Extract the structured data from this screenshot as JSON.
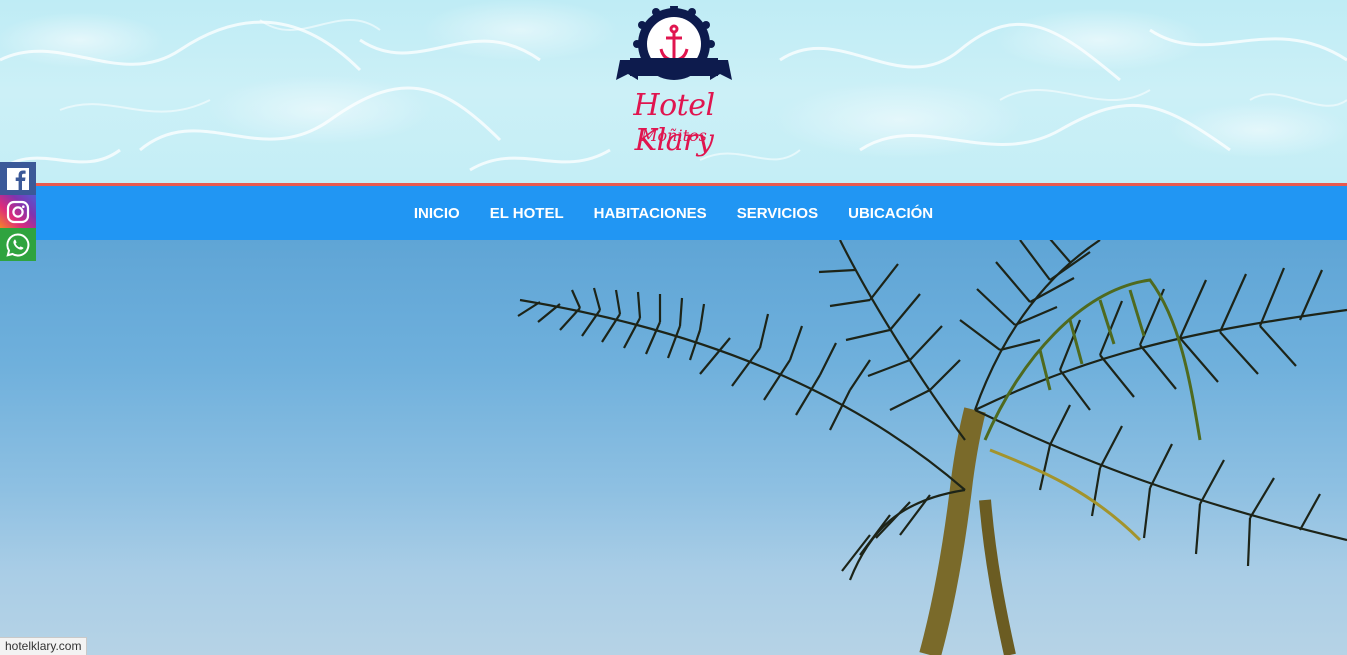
{
  "logo": {
    "title": "Hotel Klary",
    "subtitle": "Moñitos",
    "icon": "anchor-icon",
    "brand_color": "#e0154f",
    "badge_color": "#0d1b4d"
  },
  "nav": {
    "background": "#2196f3",
    "border_color": "#e95a4f",
    "items": [
      {
        "label": "INICIO"
      },
      {
        "label": "EL HOTEL"
      },
      {
        "label": "HABITACIONES"
      },
      {
        "label": "SERVICIOS"
      },
      {
        "label": "UBICACIÓN"
      }
    ]
  },
  "social": [
    {
      "icon": "facebook-icon",
      "color": "#3b5998"
    },
    {
      "icon": "instagram-icon",
      "color": "#dd2a7b"
    },
    {
      "icon": "whatsapp-icon",
      "color": "#2fa33f"
    }
  ],
  "status_bar": {
    "url": "hotelklary.com"
  }
}
